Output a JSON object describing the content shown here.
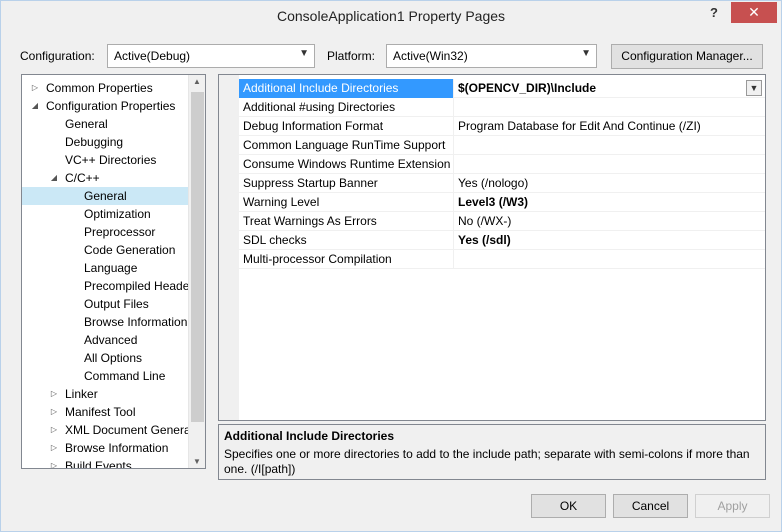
{
  "window": {
    "title": "ConsoleApplication1 Property Pages",
    "help_icon": "?",
    "close_icon": "✕"
  },
  "config": {
    "configuration_label": "Configuration:",
    "configuration_value": "Active(Debug)",
    "platform_label": "Platform:",
    "platform_value": "Active(Win32)",
    "manager_button": "Configuration Manager..."
  },
  "tree": {
    "items": [
      {
        "label": "Common Properties",
        "expander": "▷"
      },
      {
        "label": "Configuration Properties",
        "expander": "◢"
      },
      {
        "label": "General",
        "expander": ""
      },
      {
        "label": "Debugging",
        "expander": ""
      },
      {
        "label": "VC++ Directories",
        "expander": ""
      },
      {
        "label": "C/C++",
        "expander": "◢"
      },
      {
        "label": "General",
        "expander": ""
      },
      {
        "label": "Optimization",
        "expander": ""
      },
      {
        "label": "Preprocessor",
        "expander": ""
      },
      {
        "label": "Code Generation",
        "expander": ""
      },
      {
        "label": "Language",
        "expander": ""
      },
      {
        "label": "Precompiled Heade",
        "expander": ""
      },
      {
        "label": "Output Files",
        "expander": ""
      },
      {
        "label": "Browse Information",
        "expander": ""
      },
      {
        "label": "Advanced",
        "expander": ""
      },
      {
        "label": "All Options",
        "expander": ""
      },
      {
        "label": "Command Line",
        "expander": ""
      },
      {
        "label": "Linker",
        "expander": "▷"
      },
      {
        "label": "Manifest Tool",
        "expander": "▷"
      },
      {
        "label": "XML Document Genera",
        "expander": "▷"
      },
      {
        "label": "Browse Information",
        "expander": "▷"
      },
      {
        "label": "Build Events",
        "expander": "▷"
      }
    ],
    "scroll_up": "▲",
    "scroll_down": "▼"
  },
  "grid": {
    "rows": [
      {
        "name": "Additional Include Directories",
        "value": "$(OPENCV_DIR)\\Include",
        "bold": true
      },
      {
        "name": "Additional #using Directories",
        "value": ""
      },
      {
        "name": "Debug Information Format",
        "value": "Program Database for Edit And Continue (/ZI)"
      },
      {
        "name": "Common Language RunTime Support",
        "value": ""
      },
      {
        "name": "Consume Windows Runtime Extension",
        "value": ""
      },
      {
        "name": "Suppress Startup Banner",
        "value": "Yes (/nologo)"
      },
      {
        "name": "Warning Level",
        "value": "Level3 (/W3)",
        "bold": true
      },
      {
        "name": "Treat Warnings As Errors",
        "value": "No (/WX-)"
      },
      {
        "name": "SDL checks",
        "value": "Yes (/sdl)",
        "bold": true
      },
      {
        "name": "Multi-processor Compilation",
        "value": ""
      }
    ],
    "dropdown_icon": "▼"
  },
  "description": {
    "title": "Additional Include Directories",
    "text": "Specifies one or more directories to add to the include path; separate with semi-colons if more than one.     (/I[path])"
  },
  "buttons": {
    "ok": "OK",
    "cancel": "Cancel",
    "apply": "Apply"
  }
}
